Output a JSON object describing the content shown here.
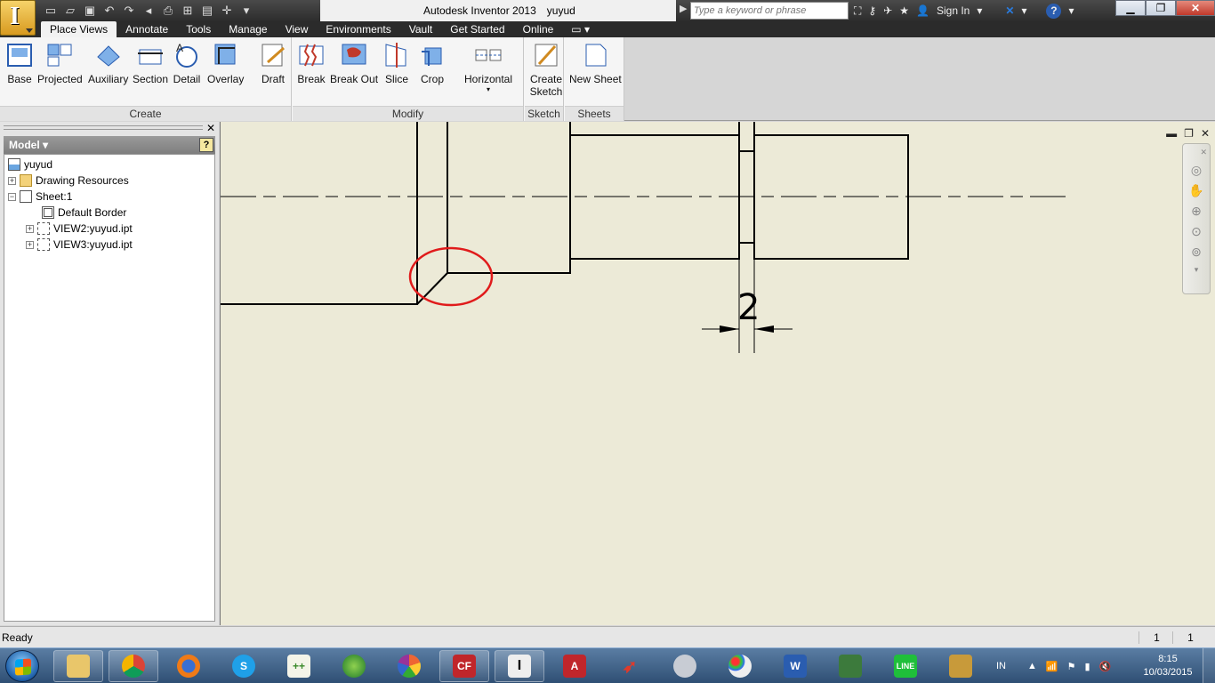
{
  "window": {
    "title_app": "Autodesk Inventor 2013",
    "title_doc": "yuyud",
    "search_placeholder": "Type a keyword or phrase",
    "sign_in": "Sign In"
  },
  "ribbon": {
    "tabs": [
      "Place Views",
      "Annotate",
      "Tools",
      "Manage",
      "View",
      "Environments",
      "Vault",
      "Get Started",
      "Online"
    ],
    "active_tab": "Place Views",
    "panels": {
      "create": {
        "label": "Create",
        "buttons": [
          "Base",
          "Projected",
          "Auxiliary",
          "Section",
          "Detail",
          "Overlay",
          "Draft"
        ]
      },
      "modify": {
        "label": "Modify",
        "buttons": [
          "Break",
          "Break Out",
          "Slice",
          "Crop",
          "Horizontal"
        ]
      },
      "sketch": {
        "label": "Sketch",
        "buttons": [
          "Create Sketch"
        ]
      },
      "sheets": {
        "label": "Sheets",
        "buttons": [
          "New Sheet"
        ]
      }
    }
  },
  "browser": {
    "header": "Model",
    "help": "?",
    "items": [
      "yuyud",
      "Drawing Resources",
      "Sheet:1",
      "Default Border",
      "VIEW2:yuyud.ipt",
      "VIEW3:yuyud.ipt"
    ]
  },
  "drawing": {
    "dimension_value": "2"
  },
  "status": {
    "text": "Ready",
    "count_a": "1",
    "count_b": "1"
  },
  "taskbar": {
    "tray_lang": "IN",
    "time": "8:15",
    "date": "10/03/2015"
  },
  "colors": {
    "canvas": "#ecead7",
    "markup_circle": "#e01b1b",
    "ribbon_bg": "#f5f5f5",
    "titlebar": "#2c2c2c"
  },
  "icons": {
    "qat": [
      "new-icon",
      "open-icon",
      "save-icon",
      "undo-icon",
      "redo-icon",
      "return-icon",
      "print-icon",
      "select-icon",
      "iproperties-icon",
      "dropdown-icon"
    ],
    "info": [
      "binoculars-icon",
      "key-icon",
      "satellite-icon",
      "star-icon",
      "user-icon",
      "exchange-icon",
      "help-icon"
    ],
    "navbar": [
      "steering-wheel-icon",
      "pan-icon",
      "zoom-icon",
      "zoom-all-icon",
      "zoom-window-icon"
    ]
  }
}
